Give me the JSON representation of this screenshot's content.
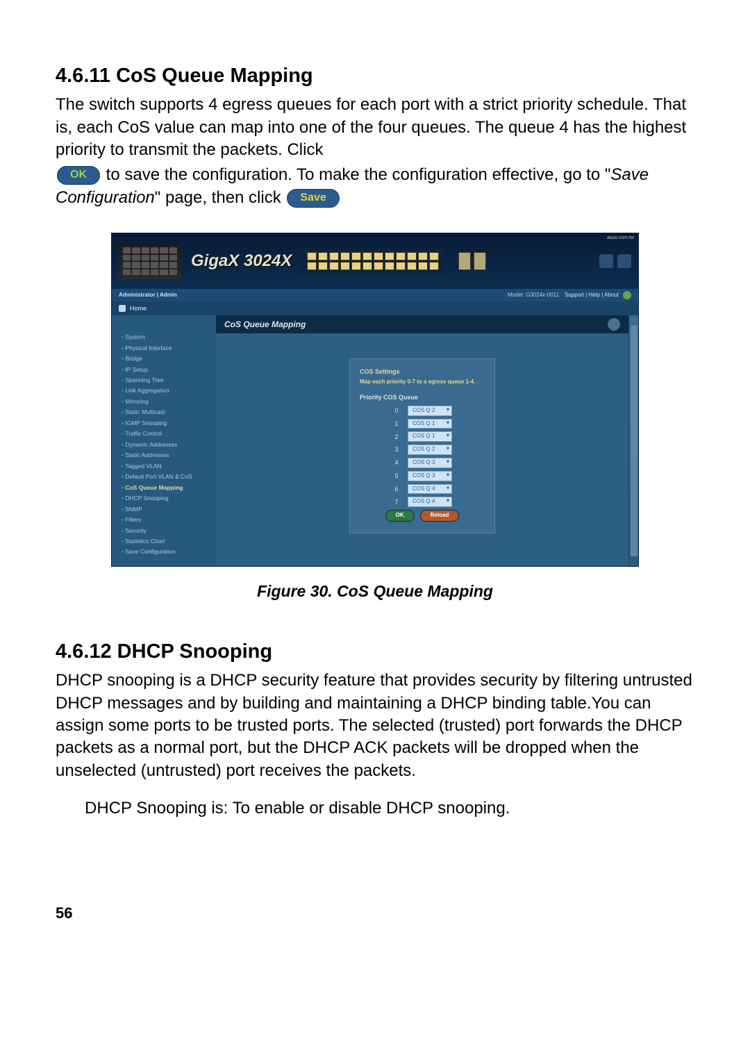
{
  "section1": {
    "heading": "4.6.11  CoS Queue Mapping",
    "p1a": "The switch supports 4 egress queues for each port with a strict priority schedule. That is, each CoS value can map into one of the four queues. The queue 4 has the highest priority to transmit the packets. Click",
    "ok_label": "OK",
    "p1b_before": "to save the configuration. To make the configuration effective, go to \"",
    "p1b_em": "Save Configuration",
    "p1b_after": "\" page, then click",
    "save_label": "Save"
  },
  "screenshot": {
    "logo": "GigaX 3024X",
    "corner": "asus.com.tw",
    "subbar_left": "Administrator   |   Admin",
    "subbar_right": "Model: G3024x-0011",
    "subbar_tabs": "Support | Help | About",
    "home": "Home",
    "sidebar": [
      "System",
      "Physical Interface",
      "Bridge",
      "IP Setup",
      "Spanning Tree",
      "Link Aggregation",
      "Mirroring",
      "Static Multicast",
      "IGMP Snooping",
      "Traffic Control",
      "Dynamic Addresses",
      "Static Addresses",
      "Tagged VLAN",
      "Default Port VLAN & CoS",
      "CoS Queue Mapping",
      "DHCP Snooping",
      "SNMP",
      "Filters",
      "Security",
      "Statistics Chart",
      "Save Configuration"
    ],
    "active_index": 14,
    "panel_title": "CoS Queue Mapping",
    "cos_hdr": "COS Settings",
    "cos_sub": "Map each priority 0-7 to a egress queue 1-4.",
    "table_hdr": "Priority  COS Queue",
    "rows": [
      {
        "prio": "0",
        "sel": "COS Q 2"
      },
      {
        "prio": "1",
        "sel": "COS Q 1"
      },
      {
        "prio": "2",
        "sel": "COS Q 1"
      },
      {
        "prio": "3",
        "sel": "COS Q 2"
      },
      {
        "prio": "4",
        "sel": "COS Q 3"
      },
      {
        "prio": "5",
        "sel": "COS Q 3"
      },
      {
        "prio": "6",
        "sel": "COS Q 4"
      },
      {
        "prio": "7",
        "sel": "COS Q 4"
      }
    ],
    "btn_ok": "OK",
    "btn_reload": "Reload"
  },
  "figure_caption": "Figure 30.  CoS Queue Mapping",
  "section2": {
    "heading": "4.6.12  DHCP Snooping",
    "p1": "DHCP snooping is a DHCP security feature that provides security by filtering untrusted DHCP messages and by building and maintaining a DHCP binding table.You can assign some ports to be trusted ports. The selected (trusted) port forwards the DHCP packets as a normal port, but the DHCP ACK packets will be dropped when the unselected (untrusted) port receives the packets.",
    "p2": "DHCP Snooping is: To enable or disable DHCP snooping."
  },
  "page_number": "56"
}
